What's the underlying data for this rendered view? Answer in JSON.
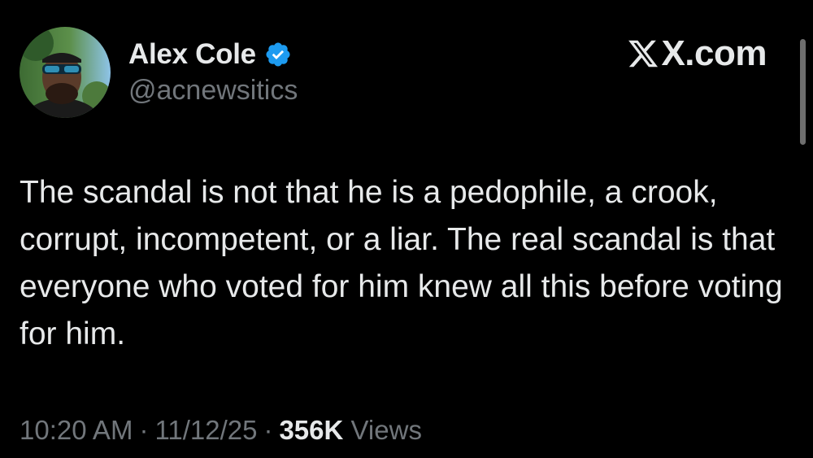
{
  "author": {
    "display_name": "Alex Cole",
    "handle": "@acnewsitics",
    "verified": true,
    "avatar_icon": "profile-photo-man-sunglasses"
  },
  "brand": {
    "domain_text": "X.com",
    "logo_icon": "x-logo-icon"
  },
  "tweet": {
    "text": "The scandal is not that he is a pedophile, a crook, corrupt, incompetent, or a liar. The real scandal is that everyone who voted for him knew all this before voting for him."
  },
  "meta": {
    "time": "10:20 AM",
    "separator": "·",
    "date": "11/12/25",
    "views_count": "356K",
    "views_label": "Views"
  },
  "colors": {
    "background": "#000000",
    "primary_text": "#e7e9ea",
    "secondary_text": "#71767b",
    "verified_blue": "#1d9bf0"
  }
}
